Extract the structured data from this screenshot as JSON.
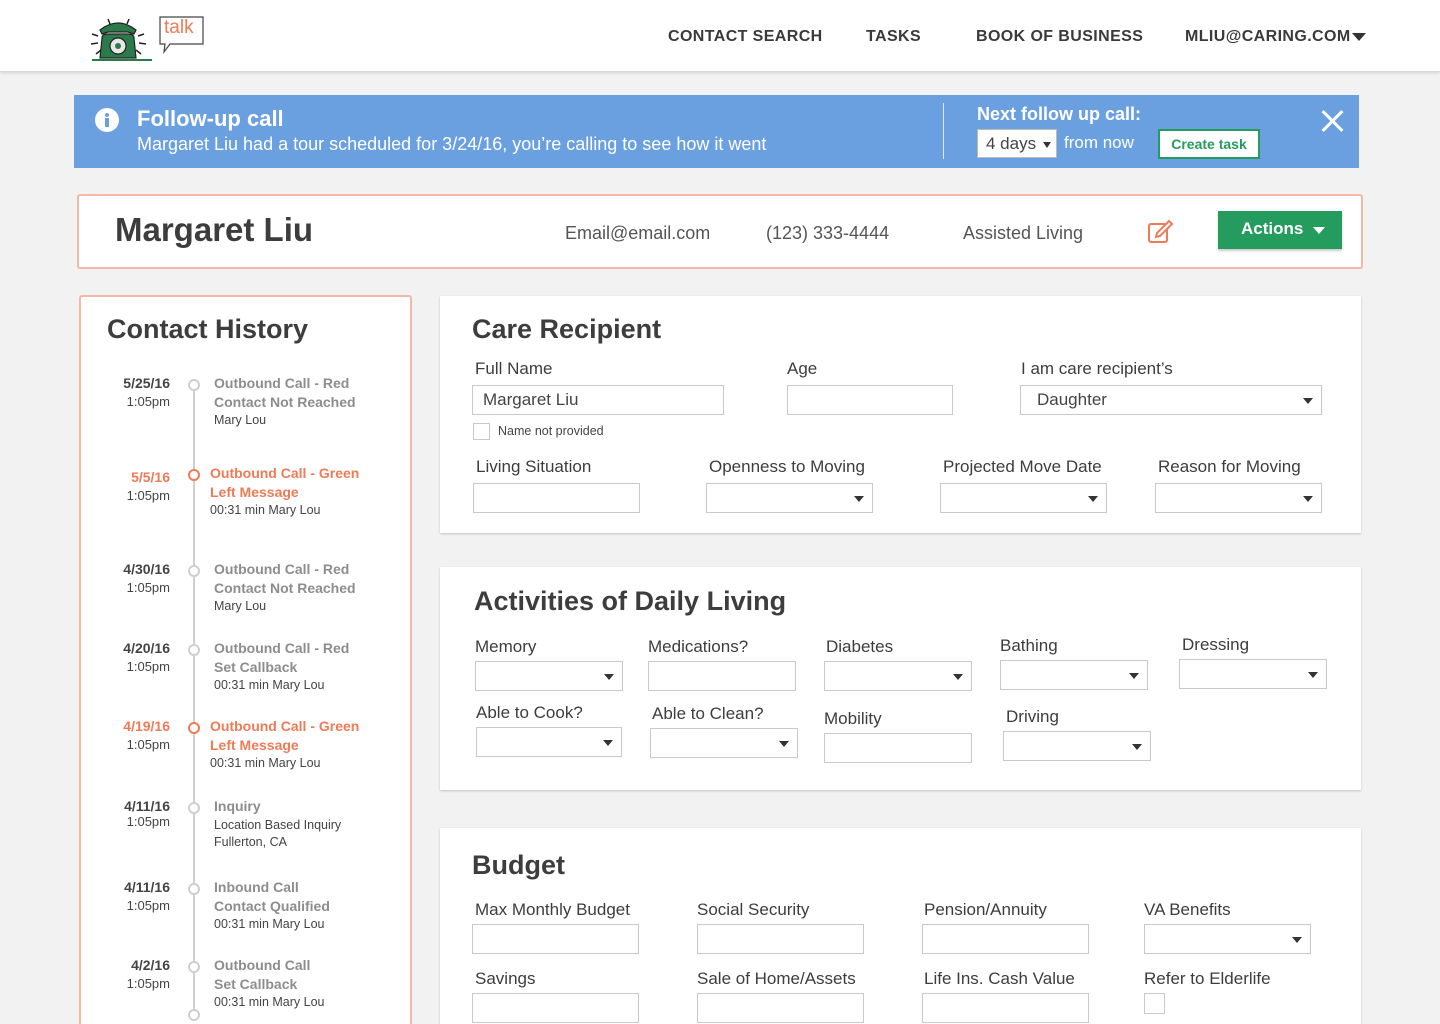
{
  "header": {
    "logo_text": "talk",
    "nav": [
      "CONTACT SEARCH",
      "TASKS",
      "BOOK OF BUSINESS"
    ],
    "user": "MLIU@CARING.COM"
  },
  "banner": {
    "title": "Follow-up call",
    "message": "Margaret Liu had a tour scheduled for 3/24/16, you’re calling to see how it went",
    "next_label": "Next follow up call:",
    "interval": "4 days",
    "from_now": "from now",
    "create_task": "Create task"
  },
  "contact": {
    "name": "Margaret Liu",
    "email": "Email@email.com",
    "phone": "(123) 333-4444",
    "care_type": "Assisted Living",
    "actions": "Actions"
  },
  "history": {
    "title": "Contact History",
    "items": [
      {
        "date": "5/25/16",
        "time": "1:05pm",
        "t1": "Outbound Call - Red",
        "t2": "Contact Not Reached",
        "t3": "Mary Lou",
        "t4": ""
      },
      {
        "date": "5/5/16",
        "time": "1:05pm",
        "t1": "Outbound Call - Green",
        "t2": "Left Message",
        "t3": "00:31 min Mary Lou",
        "t4": ""
      },
      {
        "date": "4/30/16",
        "time": "1:05pm",
        "t1": "Outbound Call - Red",
        "t2": "Contact Not Reached",
        "t3": "Mary Lou",
        "t4": ""
      },
      {
        "date": "4/20/16",
        "time": "1:05pm",
        "t1": "Outbound Call - Red",
        "t2": "Set Callback",
        "t3": "00:31 min Mary Lou",
        "t4": ""
      },
      {
        "date": "4/19/16",
        "time": "1:05pm",
        "t1": "Outbound Call - Green",
        "t2": "Left Message",
        "t3": "00:31 min Mary Lou",
        "t4": ""
      },
      {
        "date": "4/11/16",
        "time": "1:05pm",
        "t1": "Inquiry",
        "t2": "",
        "t3": "Location Based Inquiry",
        "t4": "Fullerton, CA"
      },
      {
        "date": "4/11/16",
        "time": "1:05pm",
        "t1": "Inbound Call",
        "t2": "Contact Qualified",
        "t3": "00:31 min Mary Lou",
        "t4": ""
      },
      {
        "date": "4/2/16",
        "time": "1:05pm",
        "t1": "Outbound Call",
        "t2": "Set Callback",
        "t3": "00:31 min Mary Lou",
        "t4": ""
      }
    ]
  },
  "care": {
    "title": "Care Recipient",
    "full_name_label": "Full Name",
    "full_name_value": "Margaret Liu",
    "age_label": "Age",
    "relation_label": "I am care recipient’s",
    "relation_value": "Daughter",
    "name_not_provided": "Name not provided",
    "living_label": "Living Situation",
    "openness_label": "Openness to Moving",
    "move_date_label": "Projected Move Date",
    "reason_label": "Reason for Moving"
  },
  "adl": {
    "title": "Activities of Daily Living",
    "memory": "Memory",
    "medications": "Medications?",
    "diabetes": "Diabetes",
    "bathing": "Bathing",
    "dressing": "Dressing",
    "cook": "Able to Cook?",
    "clean": "Able to Clean?",
    "mobility": "Mobility",
    "driving": "Driving"
  },
  "budget": {
    "title": "Budget",
    "max_monthly": "Max Monthly Budget",
    "social_security": "Social Security",
    "pension": "Pension/Annuity",
    "va_benefits": "VA Benefits",
    "savings": "Savings",
    "sale_home": "Sale of Home/Assets",
    "life_ins": "Life Ins. Cash Value",
    "elderlife": "Refer to Elderlife"
  },
  "colors": {
    "banner": "#6a9fe0",
    "accent_orange": "#ef7b56",
    "green": "#249c5e",
    "logo_green": "#2b7a4b"
  }
}
